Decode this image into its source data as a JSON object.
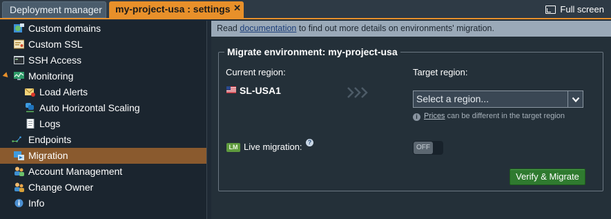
{
  "tabs": {
    "deployment_manager": "Deployment manager",
    "settings": "my-project-usa : settings",
    "close_glyph": "✕"
  },
  "fullscreen_label": "Full screen",
  "sidebar": {
    "items": [
      {
        "label": "Custom domains",
        "icon": "globe-icon"
      },
      {
        "label": "Custom SSL",
        "icon": "certificate-icon"
      },
      {
        "label": "SSH Access",
        "icon": "terminal-icon"
      },
      {
        "label": "Monitoring",
        "icon": "monitor-icon"
      },
      {
        "label": "Load Alerts",
        "icon": "alert-mail-icon"
      },
      {
        "label": "Auto Horizontal Scaling",
        "icon": "scaling-icon"
      },
      {
        "label": "Logs",
        "icon": "document-icon"
      },
      {
        "label": "Endpoints",
        "icon": "endpoints-icon"
      },
      {
        "label": "Migration",
        "icon": "migration-icon"
      },
      {
        "label": "Account Management",
        "icon": "users-icon"
      },
      {
        "label": "Change Owner",
        "icon": "owner-icon"
      },
      {
        "label": "Info",
        "icon": "info-icon"
      }
    ],
    "active": "Migration"
  },
  "infobar": {
    "prefix": "Read",
    "link": "documentation",
    "suffix": "to find out more details on environments' migration."
  },
  "migrate": {
    "legend": "Migrate environment: my-project-usa",
    "current_region_label": "Current region:",
    "current_region_value": "SL-USA1",
    "target_region_label": "Target region:",
    "target_region_placeholder": "Select a region...",
    "prices_link": "Prices",
    "prices_note": "can be different in the target region",
    "lm_badge": "LM",
    "live_migration_label": "Live migration:",
    "toggle_state": "OFF",
    "verify_button": "Verify & Migrate"
  },
  "colors": {
    "accent": "#e8902a",
    "active_item": "#8a5a2e",
    "button_green": "#2f7a2f"
  }
}
